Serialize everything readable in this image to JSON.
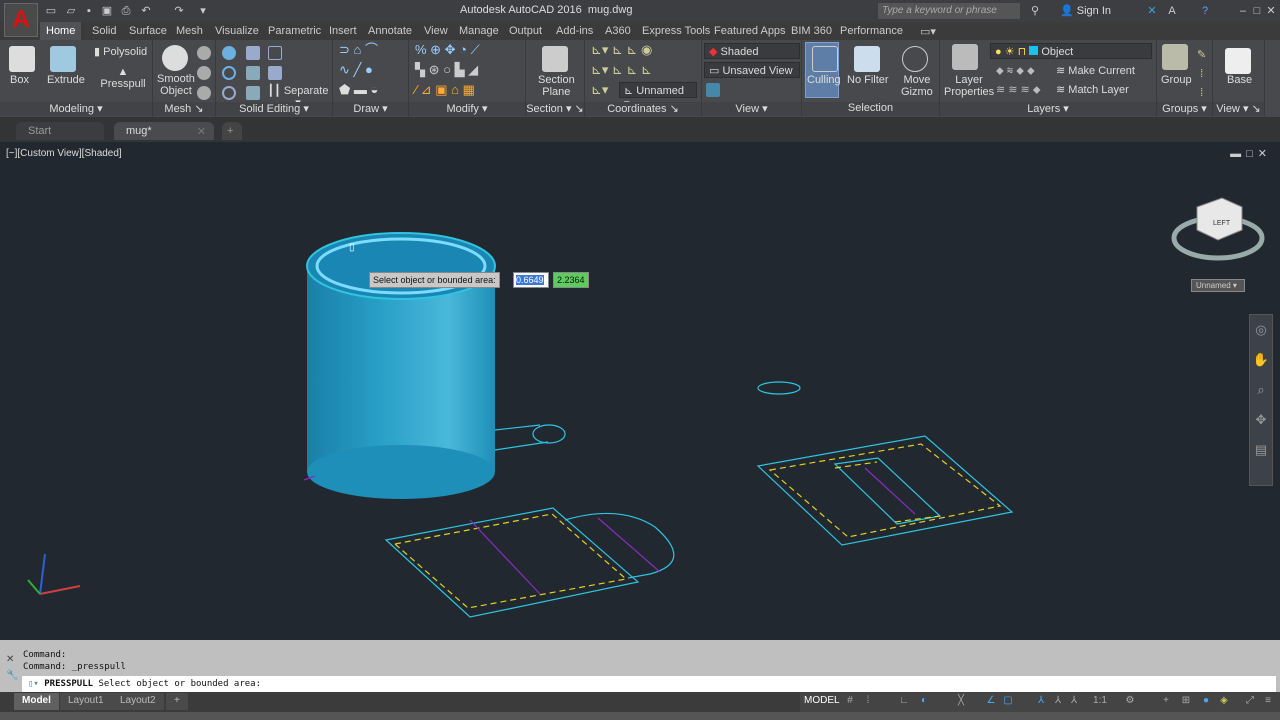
{
  "app": {
    "logo_letter": "A",
    "title": "Autodesk AutoCAD 2016",
    "filename": "mug.dwg",
    "search_placeholder": "Type a keyword or phrase",
    "sign_in": "Sign In"
  },
  "ribbon_tabs": [
    "Home",
    "Solid",
    "Surface",
    "Mesh",
    "Visualize",
    "Parametric",
    "Insert",
    "Annotate",
    "View",
    "Manage",
    "Output",
    "Add-ins",
    "A360",
    "Express Tools",
    "Featured Apps",
    "BIM 360",
    "Performance"
  ],
  "ribbon": {
    "modeling": {
      "label": "Modeling",
      "box": "Box",
      "extrude": "Extrude",
      "polysolid": "Polysolid",
      "presspull": "Presspull"
    },
    "mesh": {
      "label": "Mesh",
      "smooth": "Smooth",
      "object": "Object"
    },
    "solid_editing": {
      "label": "Solid Editing",
      "separate": "Separate"
    },
    "draw": {
      "label": "Draw"
    },
    "modify": {
      "label": "Modify"
    },
    "section": {
      "label": "Section",
      "section": "Section",
      "plane": "Plane"
    },
    "coordinates": {
      "label": "Coordinates",
      "ucs": "Unnamed"
    },
    "view": {
      "label": "View",
      "visual_style": "Shaded",
      "named_view": "Unsaved View"
    },
    "selection": {
      "label": "Selection",
      "culling": "Culling",
      "no_filter": "No Filter",
      "move": "Move",
      "gizmo": "Gizmo"
    },
    "layers": {
      "label": "Layers",
      "layer_props_1": "Layer",
      "layer_props_2": "Properties",
      "current_layer": "Object",
      "make_current": "Make Current",
      "match_layer": "Match Layer"
    },
    "groups": {
      "label": "Groups",
      "group": "Group"
    },
    "view2": {
      "label": "View",
      "base": "Base"
    }
  },
  "doc_tabs": [
    "Start",
    "mug*"
  ],
  "viewport": {
    "label": "[−][Custom View][Shaded]",
    "tooltip": "Select object or bounded area:",
    "input1": "0.6649",
    "input2": "2.2364",
    "viewcube_face": "LEFT",
    "ucs_name": "Unnamed",
    "colors": {
      "mug": "#1d8fb8",
      "wire": "#2fc4e0",
      "dash": "#e0d020",
      "purple": "#8a2cc0"
    }
  },
  "command": {
    "history": [
      "Command:",
      "Command: _presspull"
    ],
    "prompt_cmd": "PRESSPULL",
    "prompt_text": "Select object or bounded area:"
  },
  "layout_tabs": [
    "Model",
    "Layout1",
    "Layout2"
  ],
  "status": {
    "model": "MODEL",
    "scale": "1:1"
  }
}
